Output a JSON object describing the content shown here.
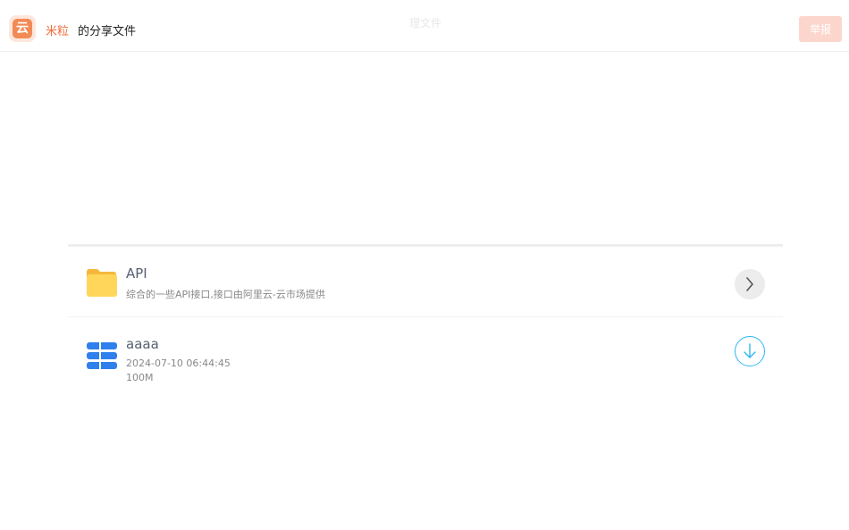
{
  "header": {
    "owner_name": "米粒",
    "share_label": "的分享文件",
    "faded_title": "理文件",
    "report_label": "举报",
    "logo_char": "云"
  },
  "items": [
    {
      "type": "folder",
      "name": "API",
      "description": "综合的一些API接口,接口由阿里云-云市场提供",
      "icon": "folder-icon",
      "action_icon": "chevron-right-icon"
    },
    {
      "type": "file",
      "name": "aaaa",
      "date": "2024-07-10 06:44:45",
      "size": "100M",
      "icon": "server-stack-icon",
      "action_icon": "download-arrow-icon"
    }
  ],
  "colors": {
    "accent": "#f26b3a",
    "folder": "#ffd65a",
    "file_icon": "#2f80ed",
    "download_ring": "#2db7f5",
    "report_bg": "#fcd6cd"
  }
}
